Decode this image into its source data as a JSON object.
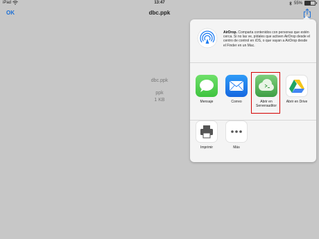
{
  "status_bar": {
    "device": "iPad",
    "time": "13:47",
    "battery": "55%",
    "battery_level": 0.55
  },
  "nav": {
    "ok_label": "OK",
    "title": "dbc.ppk",
    "share_icon": "share-icon"
  },
  "file_info": {
    "name": "dbc.ppk",
    "type": "ppk",
    "size": "1 KB"
  },
  "airdrop": {
    "title": "AirDrop.",
    "description": "Comparta contenidos con personas que estén cerca. Si no las ve, pídales que activen AirDrop desde el centro de control en iOS, o que vayan a AirDrop desde el Finder en un Mac."
  },
  "apps": [
    {
      "label": "Mensaje",
      "icon": "messages-icon",
      "color": "#4cd964"
    },
    {
      "label": "Correo",
      "icon": "mail-icon",
      "color": "#1e7cf2"
    },
    {
      "label": "Abrir en Serverauditor",
      "icon": "serverauditor-icon",
      "color": "#56b45a"
    },
    {
      "label": "Abrir en Drive",
      "icon": "google-drive-icon",
      "color": "#ffffff"
    }
  ],
  "actions": [
    {
      "label": "Imprimir",
      "icon": "printer-icon"
    },
    {
      "label": "Más",
      "icon": "more-icon"
    }
  ],
  "highlight_color": "#d40000"
}
